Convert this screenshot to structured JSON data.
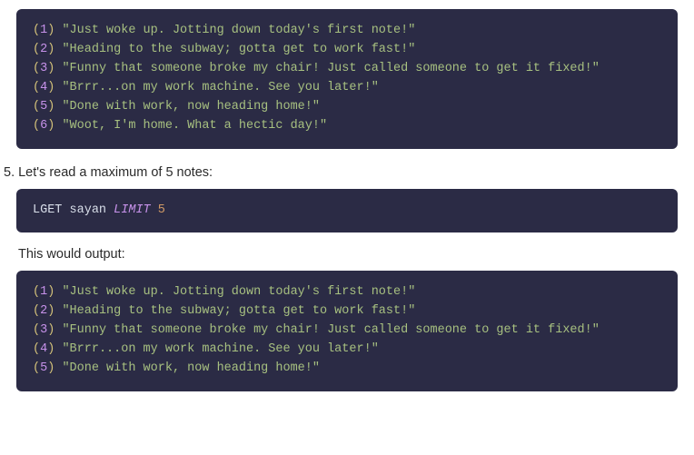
{
  "block1": {
    "lines": [
      {
        "n": "1",
        "s": "\"Just woke up. Jotting down today's first note!\""
      },
      {
        "n": "2",
        "s": "\"Heading to the subway; gotta get to work fast!\""
      },
      {
        "n": "3",
        "s": "\"Funny that someone broke my chair! Just called someone to get it fixed!\""
      },
      {
        "n": "4",
        "s": "\"Brrr...on my work machine. See you later!\""
      },
      {
        "n": "5",
        "s": "\"Done with work, now heading home!\""
      },
      {
        "n": "6",
        "s": "\"Woot, I'm home. What a hectic day!\""
      }
    ]
  },
  "step5": "5. Let's read a maximum of 5 notes:",
  "block2": {
    "cmd": "LGET",
    "ident": "sayan",
    "kw": "LIMIT",
    "lit": "5"
  },
  "outputLabel": "This would output:",
  "block3": {
    "lines": [
      {
        "n": "1",
        "s": "\"Just woke up. Jotting down today's first note!\""
      },
      {
        "n": "2",
        "s": "\"Heading to the subway; gotta get to work fast!\""
      },
      {
        "n": "3",
        "s": "\"Funny that someone broke my chair! Just called someone to get it fixed!\""
      },
      {
        "n": "4",
        "s": "\"Brrr...on my work machine. See you later!\""
      },
      {
        "n": "5",
        "s": "\"Done with work, now heading home!\""
      }
    ]
  }
}
